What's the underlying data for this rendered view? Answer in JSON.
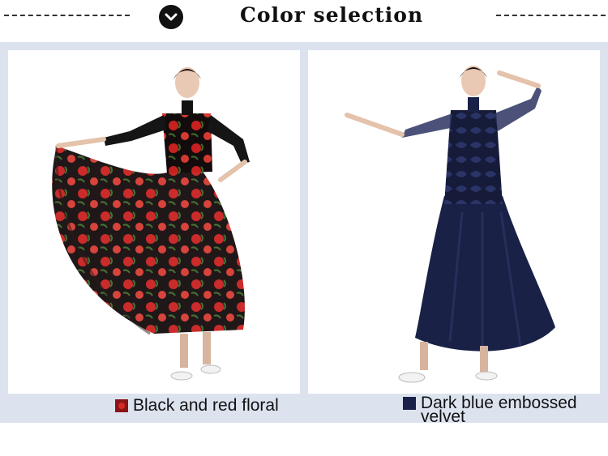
{
  "header": {
    "title": "Color selection",
    "badge_icon": "chevron-down-icon"
  },
  "options": [
    {
      "label": "Black and red floral",
      "swatch_color": "#8a1418"
    },
    {
      "label": "Dark blue embossed velvet",
      "swatch_color": "#1a2148"
    }
  ]
}
